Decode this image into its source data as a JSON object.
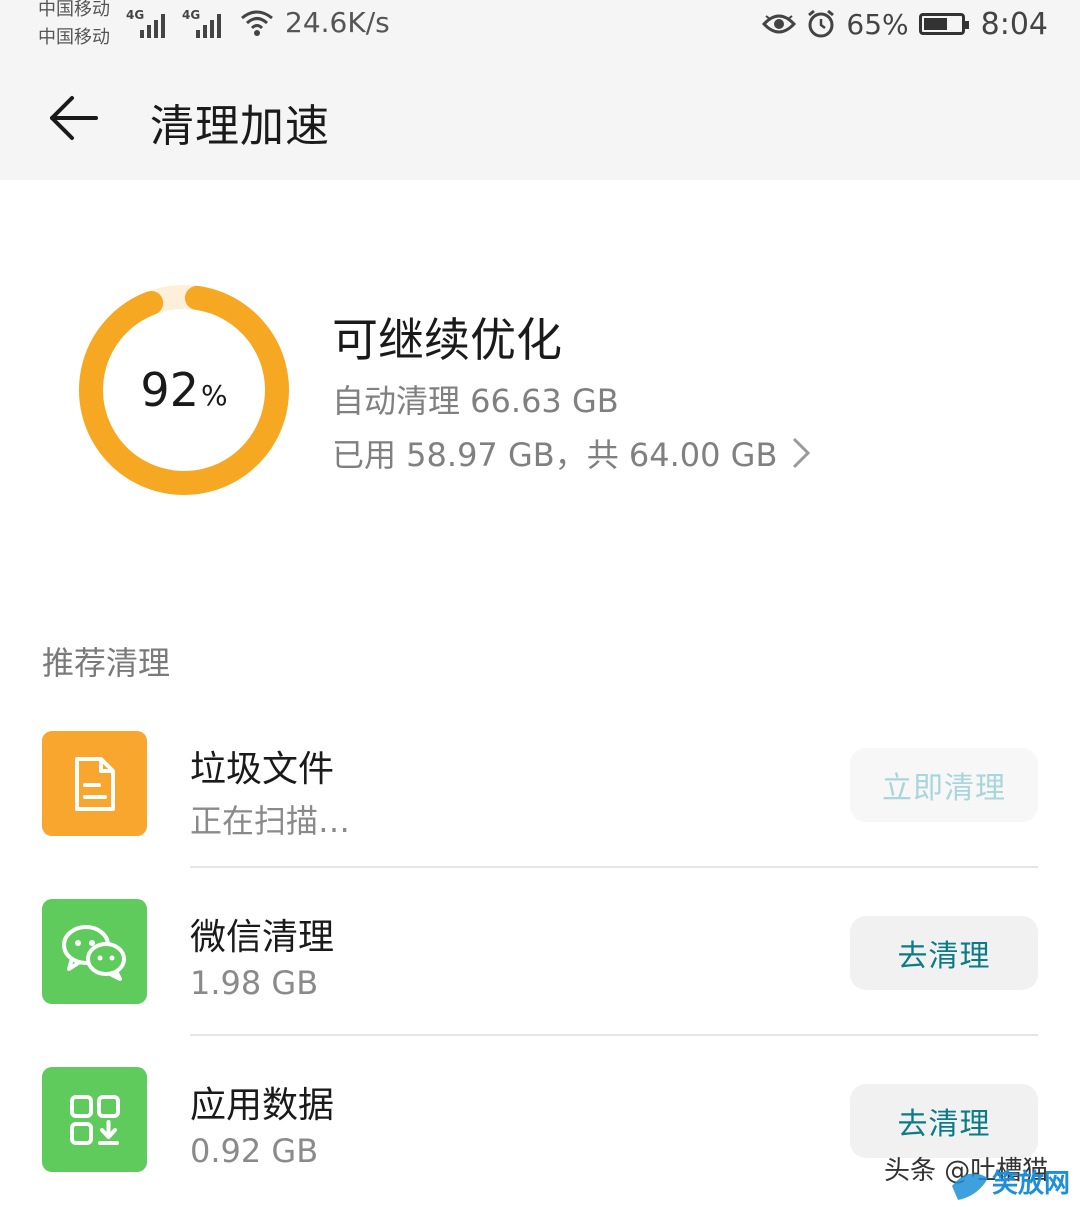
{
  "status_bar": {
    "carrier1": "中国移动",
    "carrier2": "中国移动",
    "network1": "4G",
    "network2": "4G",
    "speed": "24.6K/s",
    "battery": "65%",
    "battery_level": 0.65,
    "time": "8:04"
  },
  "header": {
    "title": "清理加速"
  },
  "summary": {
    "percent": 92,
    "percent_number": "92",
    "percent_unit": "%",
    "status": "可继续优化",
    "auto_clean": "自动清理 66.63 GB",
    "usage": "已用 58.97 GB，共 64.00 GB",
    "ring_color": "#f7a823",
    "ring_track_color": "#fdefd9"
  },
  "section": {
    "title": "推荐清理"
  },
  "items": [
    {
      "name": "垃圾文件",
      "sub": "正在扫描…",
      "button": "立即清理",
      "icon": "file-icon",
      "color": "#f8a62d"
    },
    {
      "name": "微信清理",
      "sub": "1.98 GB",
      "button": "去清理",
      "icon": "wechat-icon",
      "color": "#5fcb5c"
    },
    {
      "name": "应用数据",
      "sub": "0.92 GB",
      "button": "去清理",
      "icon": "app-data-icon",
      "color": "#5fcb5c"
    }
  ],
  "watermark": {
    "text": "头条 @吐槽猫",
    "logo_text": "笑放网"
  }
}
